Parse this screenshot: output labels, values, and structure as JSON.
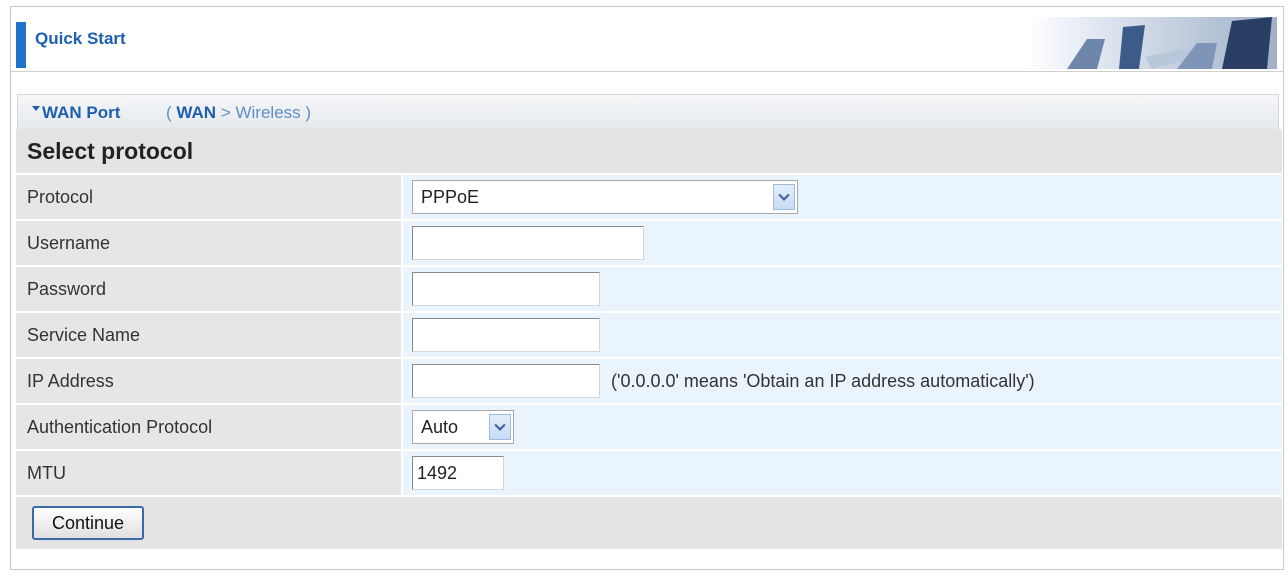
{
  "header": {
    "title": "Quick Start"
  },
  "section": {
    "title": "WAN Port",
    "crumb_open": "(",
    "crumb_current": "WAN",
    "crumb_sep": ">",
    "crumb_next": "Wireless",
    "crumb_close": ")"
  },
  "form": {
    "heading": "Select protocol",
    "fields": {
      "protocol": {
        "label": "Protocol",
        "value": "PPPoE"
      },
      "username": {
        "label": "Username",
        "value": ""
      },
      "password": {
        "label": "Password",
        "value": ""
      },
      "service_name": {
        "label": "Service Name",
        "value": ""
      },
      "ip_address": {
        "label": "IP Address",
        "value": "",
        "hint": "('0.0.0.0' means 'Obtain an IP address automatically')"
      },
      "auth_protocol": {
        "label": "Authentication Protocol",
        "value": "Auto"
      },
      "mtu": {
        "label": "MTU",
        "value": "1492"
      }
    },
    "continue_label": "Continue"
  },
  "colors": {
    "accent": "#1d5fae",
    "label_bg": "#e6e6e6",
    "value_bg": "#eaf4fc"
  }
}
